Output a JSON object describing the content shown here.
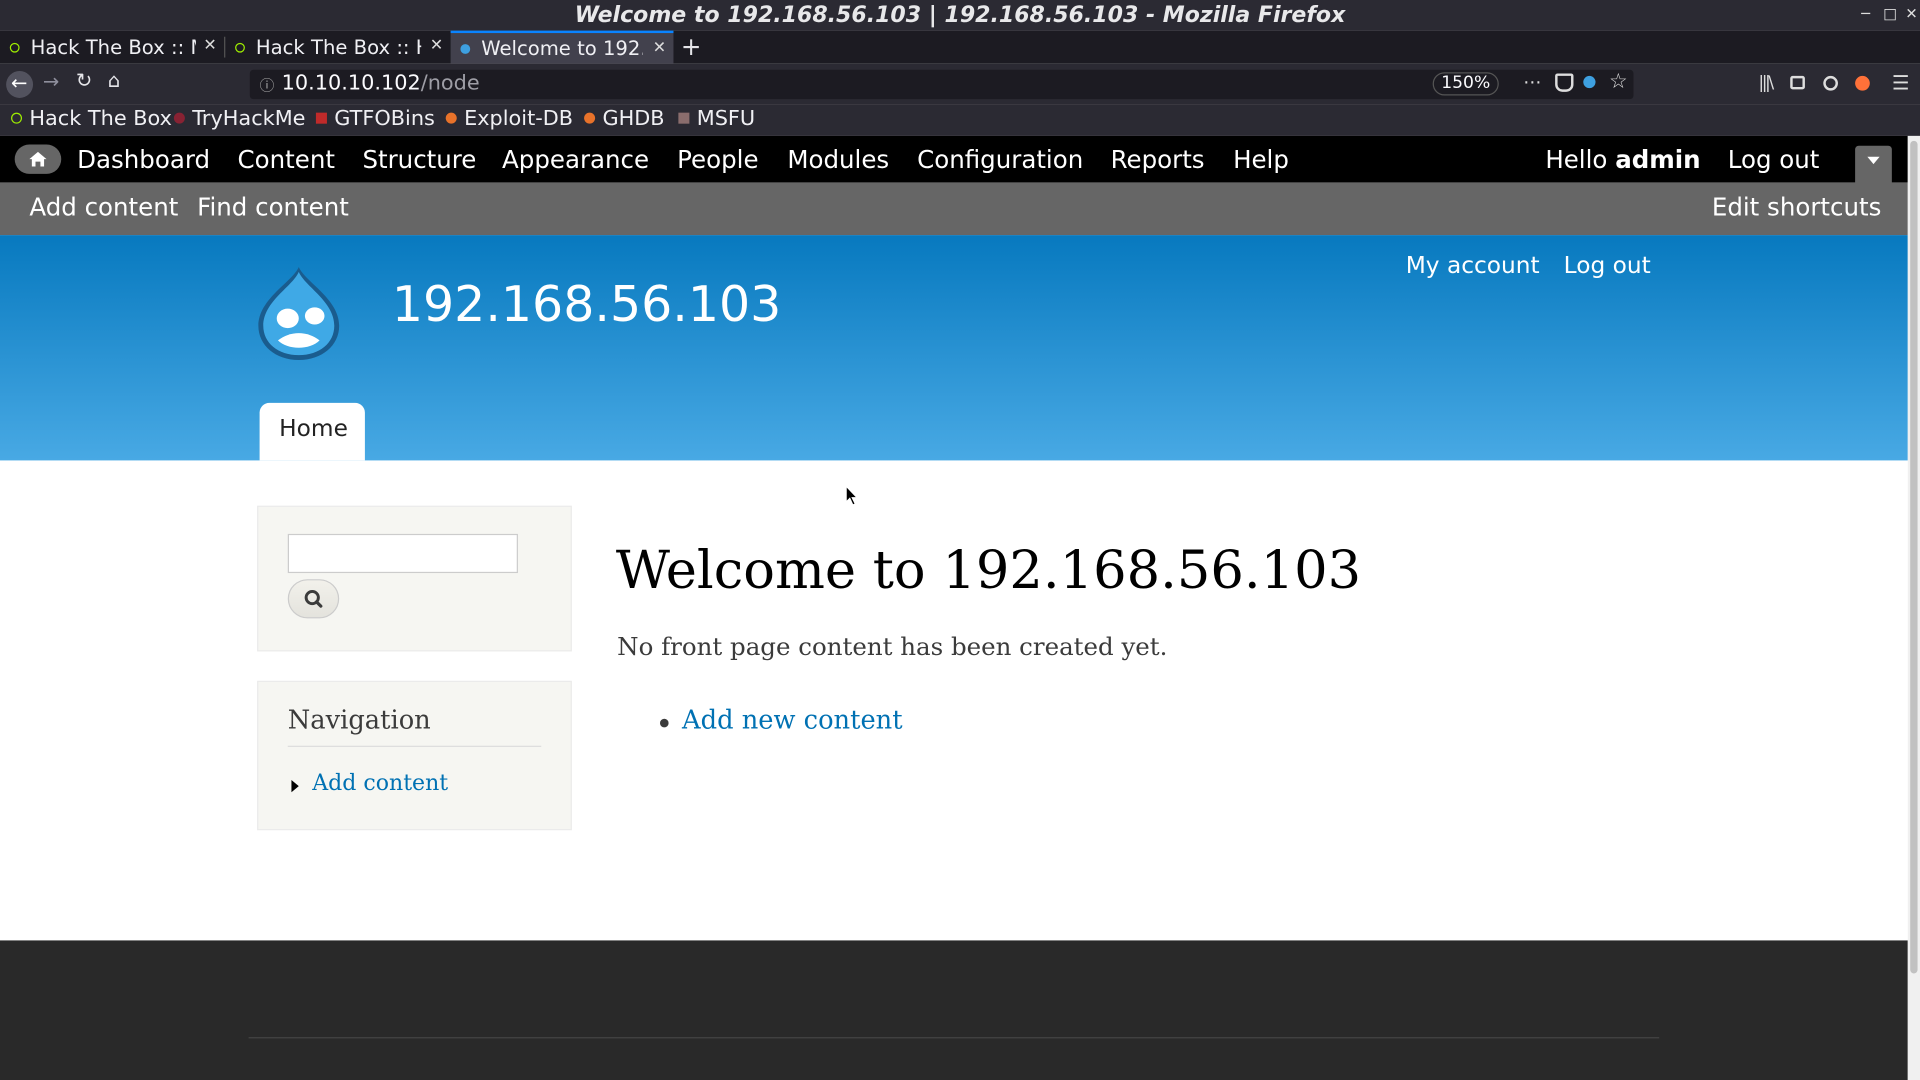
{
  "window": {
    "title": "Welcome to 192.168.56.103 | 192.168.56.103 - Mozilla Firefox"
  },
  "tabs": [
    {
      "label": "Hack The Box :: M"
    },
    {
      "label": "Hack The Box :: H"
    },
    {
      "label": "Welcome to 192.1"
    }
  ],
  "nav": {
    "url_host": "10.10.10.102",
    "url_path": "/node",
    "zoom": "150%"
  },
  "bookmarks": [
    {
      "label": "Hack The Box"
    },
    {
      "label": "TryHackMe"
    },
    {
      "label": "GTFOBins"
    },
    {
      "label": "Exploit-DB"
    },
    {
      "label": "GHDB"
    },
    {
      "label": "MSFU"
    }
  ],
  "toolbar": {
    "items": [
      {
        "label": "Dashboard"
      },
      {
        "label": "Content"
      },
      {
        "label": "Structure"
      },
      {
        "label": "Appearance"
      },
      {
        "label": "People"
      },
      {
        "label": "Modules"
      },
      {
        "label": "Configuration"
      },
      {
        "label": "Reports"
      },
      {
        "label": "Help"
      }
    ],
    "hello": "Hello ",
    "user": "admin",
    "logout": "Log out"
  },
  "shortcuts": {
    "items": [
      {
        "label": "Add content"
      },
      {
        "label": "Find content"
      }
    ],
    "edit": "Edit shortcuts"
  },
  "header": {
    "site_name": "192.168.56.103",
    "my_account": "My account",
    "logout": "Log out",
    "home_tab": "Home"
  },
  "sidebar": {
    "nav_title": "Navigation",
    "nav_items": [
      {
        "label": "Add content"
      }
    ]
  },
  "main": {
    "title": "Welcome to 192.168.56.103",
    "body": "No front page content has been created yet.",
    "link": "Add new content"
  },
  "colors": {
    "brand_blue": "#0779bf",
    "link": "#0071b3",
    "footer": "#292929"
  }
}
